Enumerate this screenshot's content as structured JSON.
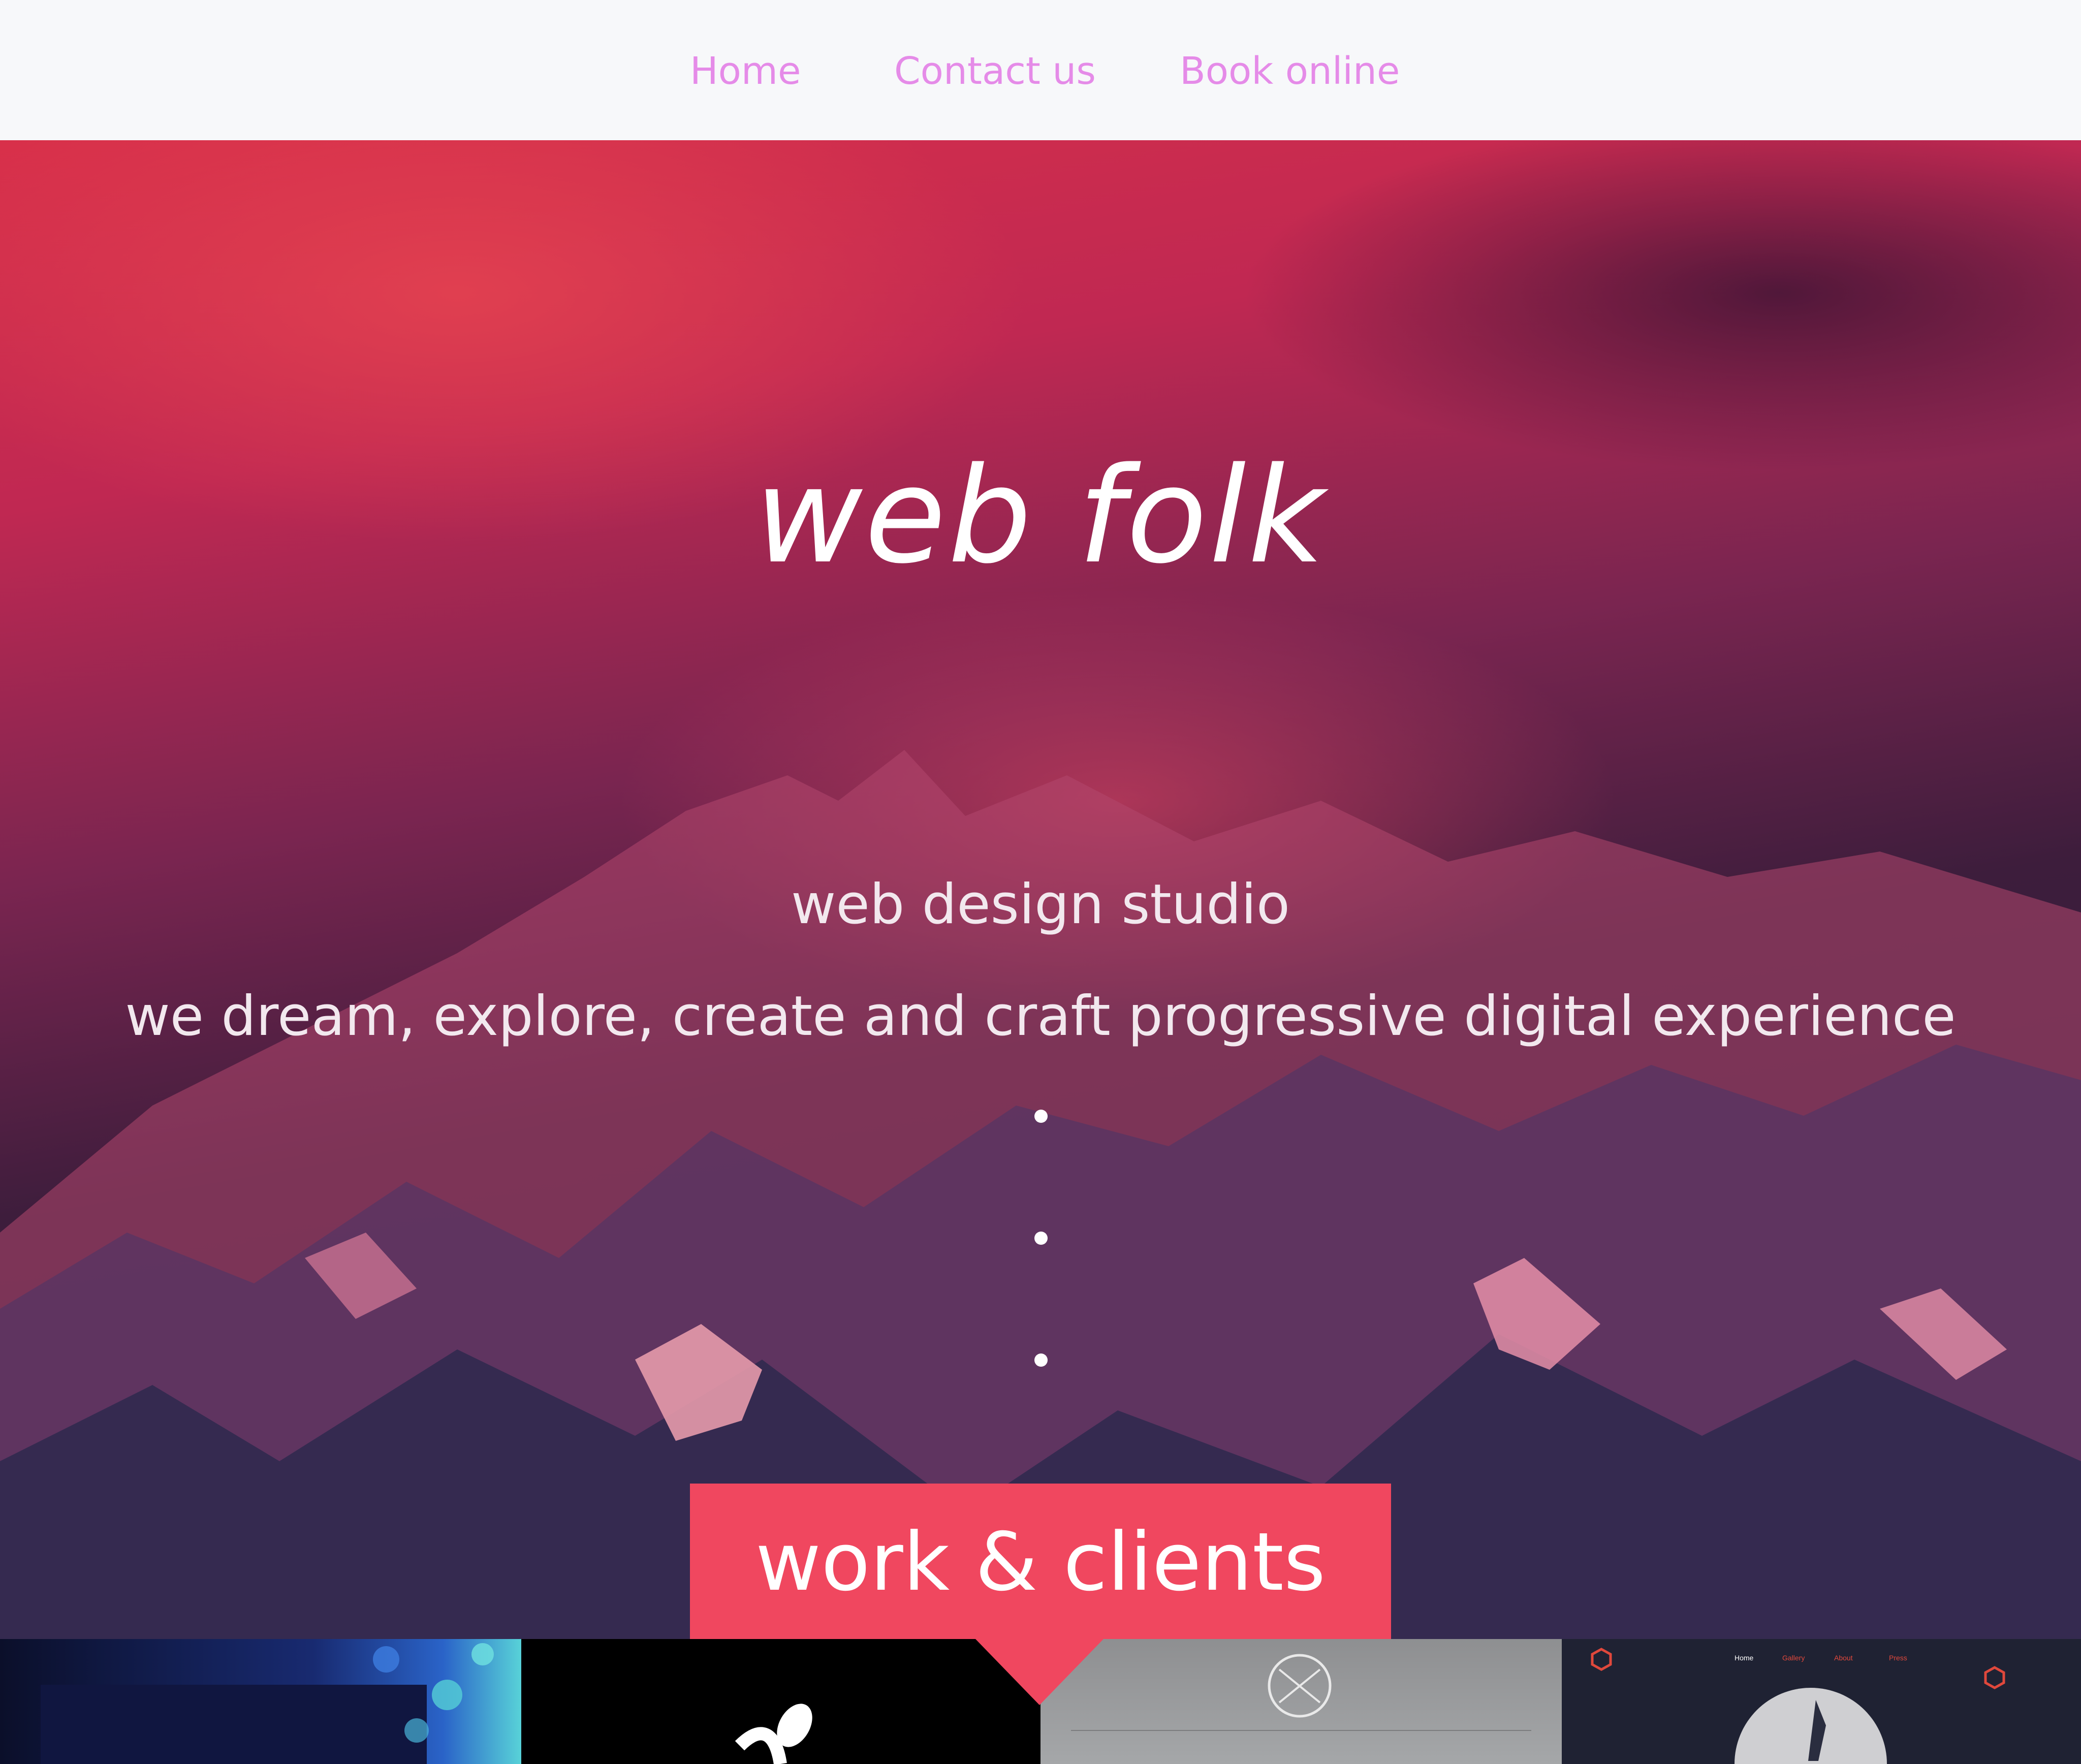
{
  "nav": {
    "home": "Home",
    "contact": "Contact us",
    "book": "Book online"
  },
  "hero": {
    "title": "web folk",
    "subtitle": "web design studio",
    "tagline": "we dream, explore, create and craft progressive digital experience",
    "dot_count": 3
  },
  "work": {
    "heading": "work & clients"
  },
  "thumbnails": {
    "items": [
      "project-1",
      "project-2",
      "project-3",
      "project-4"
    ],
    "t4_nav": [
      "Home",
      "Gallery",
      "About",
      "Press"
    ]
  },
  "colors": {
    "nav_link": "#e58be8",
    "accent": "#f0475f",
    "hero_text": "#ffffff"
  }
}
